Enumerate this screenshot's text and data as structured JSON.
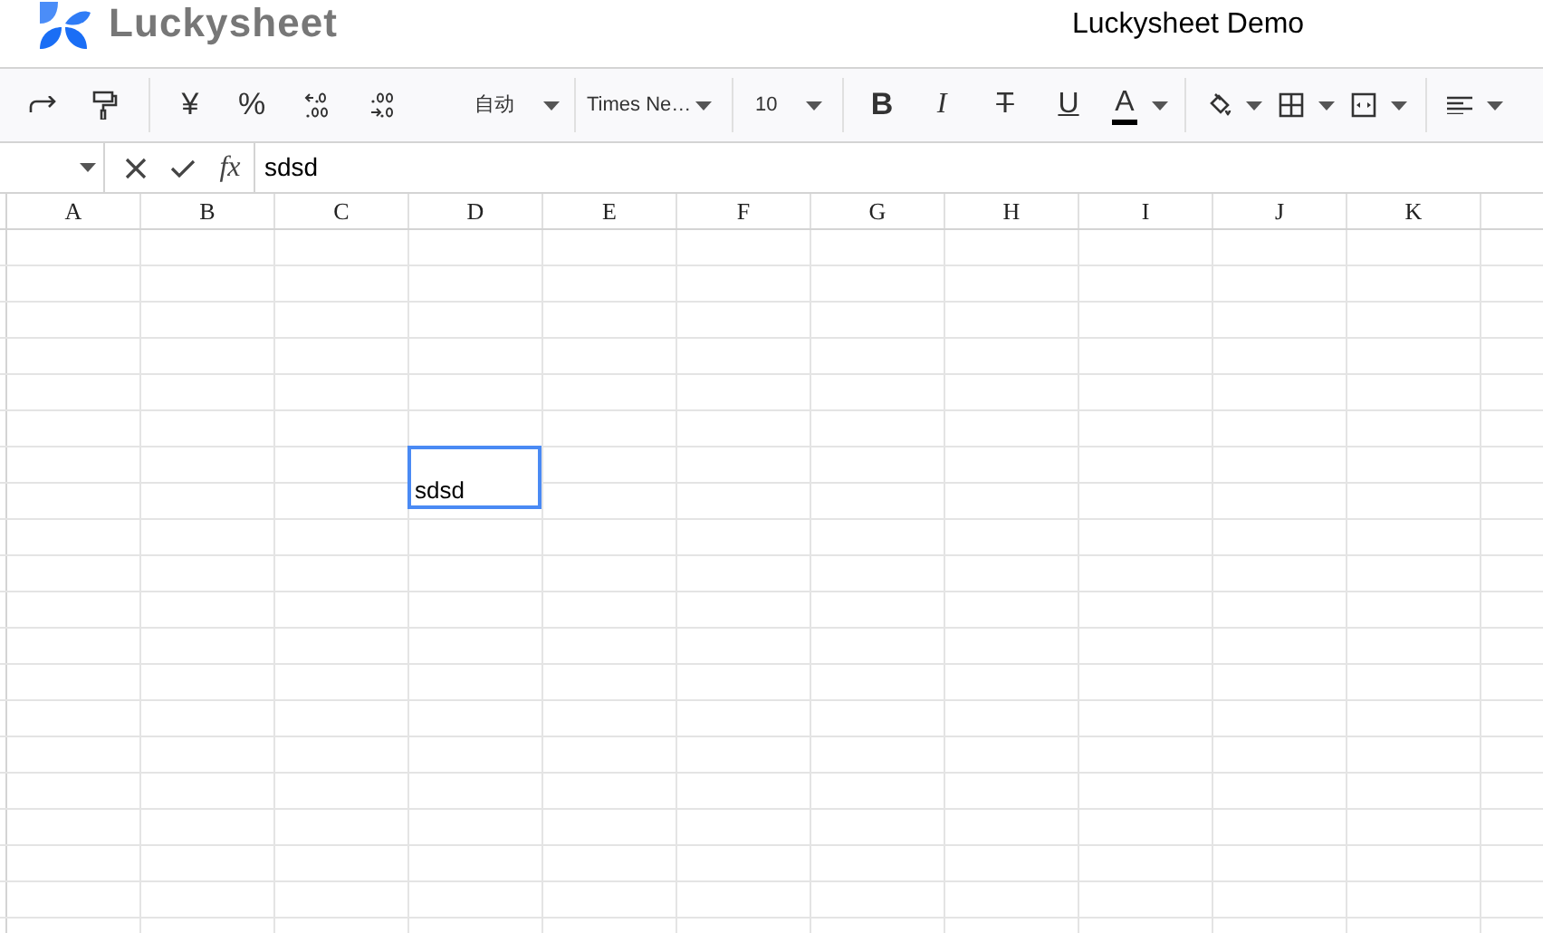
{
  "header": {
    "logo_text": "Luckysheet",
    "title": "Luckysheet Demo"
  },
  "toolbar": {
    "currency": "¥",
    "percent": "%",
    "number_format": "自动",
    "font_family": "Times Ne…",
    "font_size": "10",
    "bold": "B",
    "italic": "I",
    "strikethrough": "T",
    "underline": "U",
    "font_color": "A"
  },
  "formula_bar": {
    "function_label": "fx",
    "value": "sdsd"
  },
  "columns": [
    "A",
    "B",
    "C",
    "D",
    "E",
    "F",
    "G",
    "H",
    "I",
    "J",
    "K"
  ],
  "cell_editor": {
    "value": "sdsd"
  }
}
